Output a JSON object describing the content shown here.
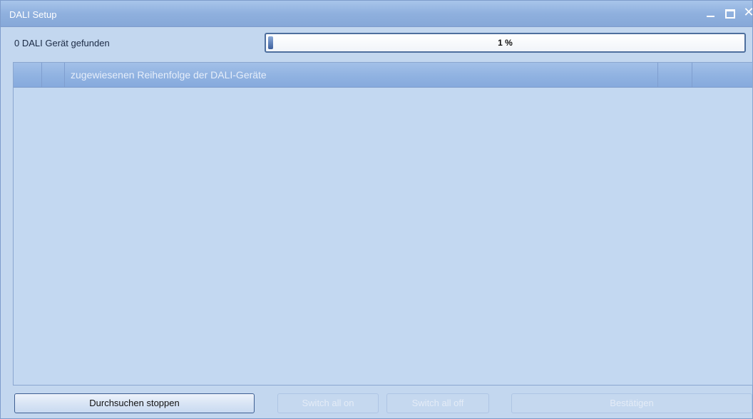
{
  "window": {
    "title": "DALI Setup"
  },
  "status": {
    "devices_found": "0 DALI Gerät gefunden",
    "progress_text": "1 %",
    "progress_fraction": 0.01
  },
  "grid": {
    "columns": [
      "",
      "",
      "zugewiesenen Reihenfolge der DALI-Geräte",
      "",
      ""
    ],
    "rows": []
  },
  "buttons": {
    "stop_search": "Durchsuchen stoppen",
    "switch_all_on": "Switch all on",
    "switch_all_off": "Switch all off",
    "confirm": "Bestätigen"
  },
  "colors": {
    "titlebar": "#8fb0de",
    "window_bg": "#c3d7ef",
    "progress_fill": "#3d5f9d"
  },
  "icons": {
    "minimize": "minimize-icon",
    "maximize": "maximize-icon",
    "close": "close-icon"
  }
}
